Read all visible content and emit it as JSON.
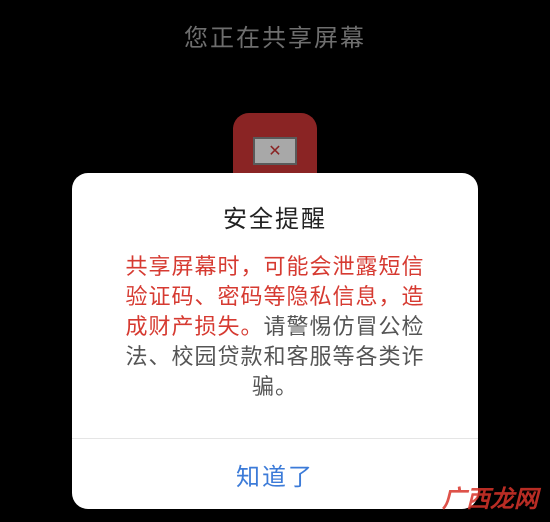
{
  "screen": {
    "title": "您正在共享屏幕"
  },
  "stop_share": {
    "icon": "close-icon",
    "glyph": "✕",
    "colors": {
      "background": "#8a2424"
    }
  },
  "dialog": {
    "title": "安全提醒",
    "message_lines": [
      {
        "warn": "共享屏幕时，可能会泄露短信",
        "normal": ""
      },
      {
        "warn": "验证码、密码等隐私信息，造",
        "normal": ""
      },
      {
        "warn": "成财产损失。",
        "normal": "请警惕仿冒公检"
      },
      {
        "warn": "",
        "normal": "法、校园贷款和客服等各类诈"
      },
      {
        "warn": "",
        "normal": "骗。"
      }
    ],
    "confirm_label": "知道了",
    "colors": {
      "warning_text": "#d63a31",
      "confirm_text": "#3c7bd8"
    }
  },
  "watermark": {
    "text": "广西龙网"
  }
}
